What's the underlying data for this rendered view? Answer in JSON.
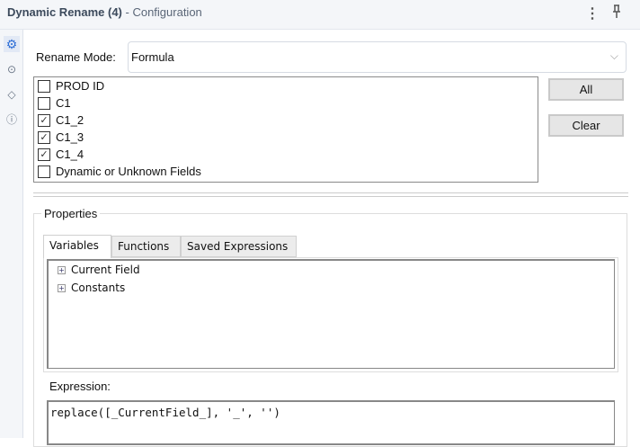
{
  "header": {
    "title": "Dynamic Rename (4)",
    "subtitle": "- Configuration",
    "more_icon": "kebab-icon",
    "pin_icon": "pin-icon"
  },
  "sidebar": {
    "icons": [
      "gear-icon",
      "connection-icon",
      "tag-icon",
      "help-icon"
    ]
  },
  "rename_mode": {
    "label": "Rename Mode:",
    "value": "Formula"
  },
  "fields": [
    {
      "label": "PROD ID",
      "checked": false
    },
    {
      "label": "C1",
      "checked": false
    },
    {
      "label": "C1_2",
      "checked": true
    },
    {
      "label": "C1_3",
      "checked": true
    },
    {
      "label": "C1_4",
      "checked": true
    },
    {
      "label": "Dynamic or Unknown Fields",
      "checked": false
    }
  ],
  "buttons": {
    "all": "All",
    "clear": "Clear"
  },
  "properties": {
    "title": "Properties",
    "tabs": [
      "Variables",
      "Functions",
      "Saved Expressions"
    ],
    "active_tab": "Variables",
    "tree": [
      "Current Field",
      "Constants"
    ],
    "expression_label": "Expression:",
    "expression": "replace([_CurrentField_], '_', '')"
  }
}
